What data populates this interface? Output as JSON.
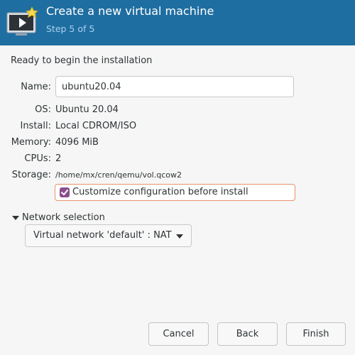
{
  "header": {
    "title": "Create a new virtual machine",
    "step": "Step 5 of 5",
    "icon": "monitor-play-icon"
  },
  "ready_heading": "Ready to begin the installation",
  "fields": {
    "name_label": "Name:",
    "name_value": "ubuntu20.04",
    "os_label": "OS:",
    "os_value": "Ubuntu 20.04",
    "install_label": "Install:",
    "install_value": "Local CDROM/ISO",
    "memory_label": "Memory:",
    "memory_value": "4096 MiB",
    "cpus_label": "CPUs:",
    "cpus_value": "2",
    "storage_label": "Storage:",
    "storage_value": "/home/mx/cren/qemu/vol.qcow2"
  },
  "customize": {
    "label": "Customize configuration before install",
    "checked": true
  },
  "network": {
    "label": "Network selection",
    "selected": "Virtual network 'default' : NAT"
  },
  "buttons": {
    "cancel": "Cancel",
    "back": "Back",
    "finish": "Finish"
  },
  "colors": {
    "header_bg": "#1f6ea1",
    "step_text": "#a9d1ef",
    "checkbox": "#8a4f8e",
    "focus_border": "#e8956b"
  }
}
